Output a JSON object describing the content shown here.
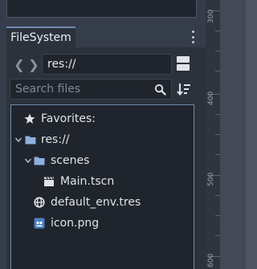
{
  "dock": {
    "tab_label": "FileSystem",
    "path_value": "res://",
    "search_placeholder": "Search files"
  },
  "tree": {
    "items": [
      {
        "label": "Favorites:",
        "icon": "star-icon"
      },
      {
        "label": "res://",
        "icon": "folder-icon"
      },
      {
        "label": "scenes",
        "icon": "folder-icon"
      },
      {
        "label": "Main.tscn",
        "icon": "scene-clapper-icon"
      },
      {
        "label": "default_env.tres",
        "icon": "globe-icon"
      },
      {
        "label": "icon.png",
        "icon": "image-icon"
      }
    ]
  },
  "ruler": {
    "labels": [
      "300",
      "400",
      "500",
      "600"
    ]
  },
  "colors": {
    "accent": "#6f8aaf",
    "folder": "#8db0e0",
    "panel": "#2c323c",
    "tree_bg": "#20252d"
  }
}
